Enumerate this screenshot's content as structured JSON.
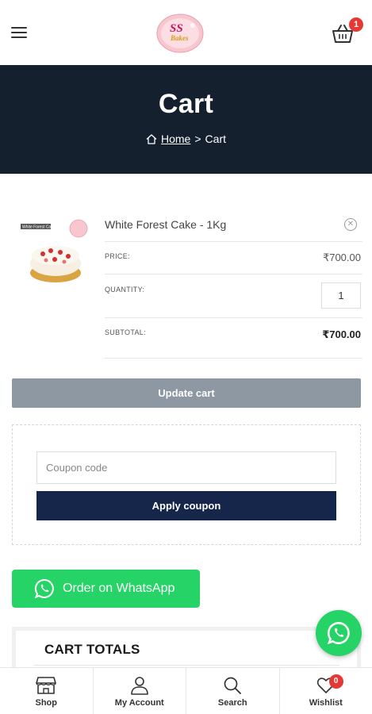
{
  "header": {
    "cart_count": "1",
    "logo_text": "SS Bakes"
  },
  "hero": {
    "title": "Cart",
    "breadcrumb_home": "Home",
    "breadcrumb_separator": ">",
    "breadcrumb_current": "Cart"
  },
  "cart": {
    "item": {
      "name": "White Forest Cake - 1Kg",
      "thumb_label": "White Forest Cake",
      "price_label": "PRICE:",
      "price": "₹700.00",
      "quantity_label": "QUANTITY:",
      "quantity": "1",
      "subtotal_label": "SUBTOTAL:",
      "subtotal": "₹700.00"
    },
    "update_label": "Update cart"
  },
  "coupon": {
    "placeholder": "Coupon code",
    "apply_label": "Apply coupon"
  },
  "whatsapp": {
    "order_label": "Order on WhatsApp"
  },
  "totals": {
    "title": "CART TOTALS"
  },
  "bottom_nav": {
    "items": [
      {
        "label": "Shop",
        "icon": "shop-icon"
      },
      {
        "label": "My Account",
        "icon": "user-icon"
      },
      {
        "label": "Search",
        "icon": "search-icon"
      },
      {
        "label": "Wishlist",
        "icon": "heart-icon",
        "badge": "0"
      }
    ]
  },
  "colors": {
    "hero_bg": "#15202f",
    "accent_red": "#e53935",
    "whatsapp_green": "#25d366",
    "apply_button": "#15264a",
    "update_button": "#8d98a3"
  }
}
